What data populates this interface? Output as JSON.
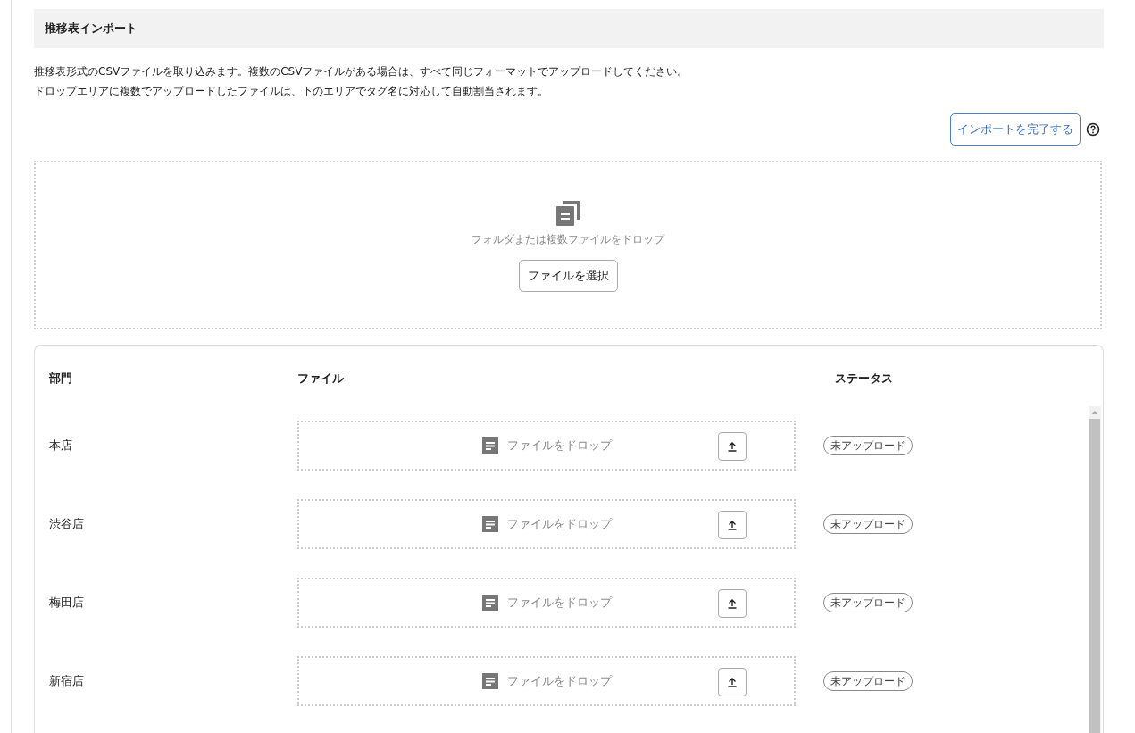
{
  "section": {
    "title": "推移表インポート"
  },
  "description": [
    "推移表形式のCSVファイルを取り込みます。複数のCSVファイルがある場合は、すべて同じフォーマットでアップロードしてください。",
    "ドロップエリアに複数でアップロードしたファイルは、下のエリアでタグ名に対応して自動割当されます。"
  ],
  "complete_button": "インポートを完了する",
  "drop_area": {
    "text": "フォルダまたは複数ファイルをドロップ",
    "button": "ファイルを選択"
  },
  "table": {
    "columns": [
      "部門",
      "ファイル",
      "ステータス"
    ],
    "rows": [
      {
        "department": "本店",
        "file_placeholder": "ファイルをドロップ",
        "status": "未アップロード"
      },
      {
        "department": "渋谷店",
        "file_placeholder": "ファイルをドロップ",
        "status": "未アップロード"
      },
      {
        "department": "梅田店",
        "file_placeholder": "ファイルをドロップ",
        "status": "未アップロード"
      },
      {
        "department": "新宿店",
        "file_placeholder": "ファイルをドロップ",
        "status": "未アップロード"
      }
    ]
  }
}
